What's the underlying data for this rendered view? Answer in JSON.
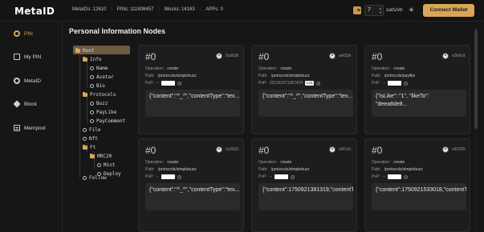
{
  "header": {
    "logo": "MetaID",
    "stats": {
      "metaids": "MetaIDs: 12610",
      "pins": "PINs: 111808457",
      "blocks": "Blocks: 14163",
      "apps": "APPs: 0"
    },
    "fee_value": "7",
    "fee_unit": "sats/vb",
    "connect_label": "Connect Wallet"
  },
  "sidebar": {
    "items": [
      {
        "label": "PIN",
        "icon": "pin-icon",
        "active": true
      },
      {
        "label": "My PIN",
        "icon": "my-pin-icon",
        "active": false
      },
      {
        "label": "MetaID",
        "icon": "metaid-icon",
        "active": false
      },
      {
        "label": "Block",
        "icon": "block-icon",
        "active": false
      },
      {
        "label": "Mempool",
        "icon": "mempool-icon",
        "active": false
      }
    ]
  },
  "main": {
    "title": "Personal Information Nodes"
  },
  "tree": {
    "root": "Root",
    "info": "Info",
    "name": "Name",
    "avatar": "Avatar",
    "bio": "Bio",
    "protocols": "Protocols",
    "buzz": "Buzz",
    "paylike": "PayLike",
    "paycomment": "PayComment",
    "file": "File",
    "nft": "Nft",
    "ft": "Ft",
    "mrc20": "MRC20",
    "mint": "Mint",
    "deploy": "Deploy",
    "follow": "Follow"
  },
  "cards": [
    {
      "number": "#0",
      "hash": "0cd036",
      "op_label": "Operation:",
      "op": "create",
      "path_label": "Path:",
      "path": "/protocols/simplebuzz",
      "pop_label": "PoP:",
      "pop_prefix": "--",
      "level": "",
      "content": "{\"content\":\"^_^\",\"contentType\":\"tex..."
    },
    {
      "number": "#0",
      "hash": "aef33d",
      "op_label": "Operation:",
      "op": "create",
      "path_label": "Path:",
      "path": "/protocols/simplebuzz",
      "pop_label": "PoP:",
      "pop_prefix": "021162371367424",
      "level": "Lv1",
      "content": "{\"content\":\"^_^\",\"contentType\":\"tex..."
    },
    {
      "number": "#0",
      "hash": "e3b6cd",
      "op_label": "Operation:",
      "op": "create",
      "path_label": "Path:",
      "path": "/protocols/paylike",
      "pop_label": "PoP:",
      "pop_prefix": "--",
      "level": "",
      "content": "{\"isLike\": \"1\", \"likeTo\": \"deea8de8..."
    },
    {
      "number": "#0",
      "hash": "1c0501",
      "op_label": "Operation:",
      "op": "create",
      "path_label": "Path:",
      "path": "/protocols/simplebuzz",
      "pop_label": "PoP:",
      "pop_prefix": "--",
      "level": "",
      "content": "{\"content\":\"^_^\",\"contentType\":\"tex..."
    },
    {
      "number": "#0",
      "hash": "c6f7a3",
      "op_label": "Operation:",
      "op": "create",
      "path_label": "Path:",
      "path": "/protocols/simplebuzz",
      "pop_label": "PoP:",
      "pop_prefix": "--",
      "level": "",
      "content": "{\"content\":1750921391319,\"contentTy..."
    },
    {
      "number": "#0",
      "hash": "c60250",
      "op_label": "Operation:",
      "op": "create",
      "path_label": "Path:",
      "path": "/protocols/simplebuzz",
      "pop_label": "PoP:",
      "pop_prefix": "--",
      "level": "",
      "content": "{\"content\":1750921533018,\"contentTy..."
    }
  ],
  "colors": {
    "accent": "#d9a657",
    "background": "#161616",
    "card": "#1d1d1d"
  }
}
